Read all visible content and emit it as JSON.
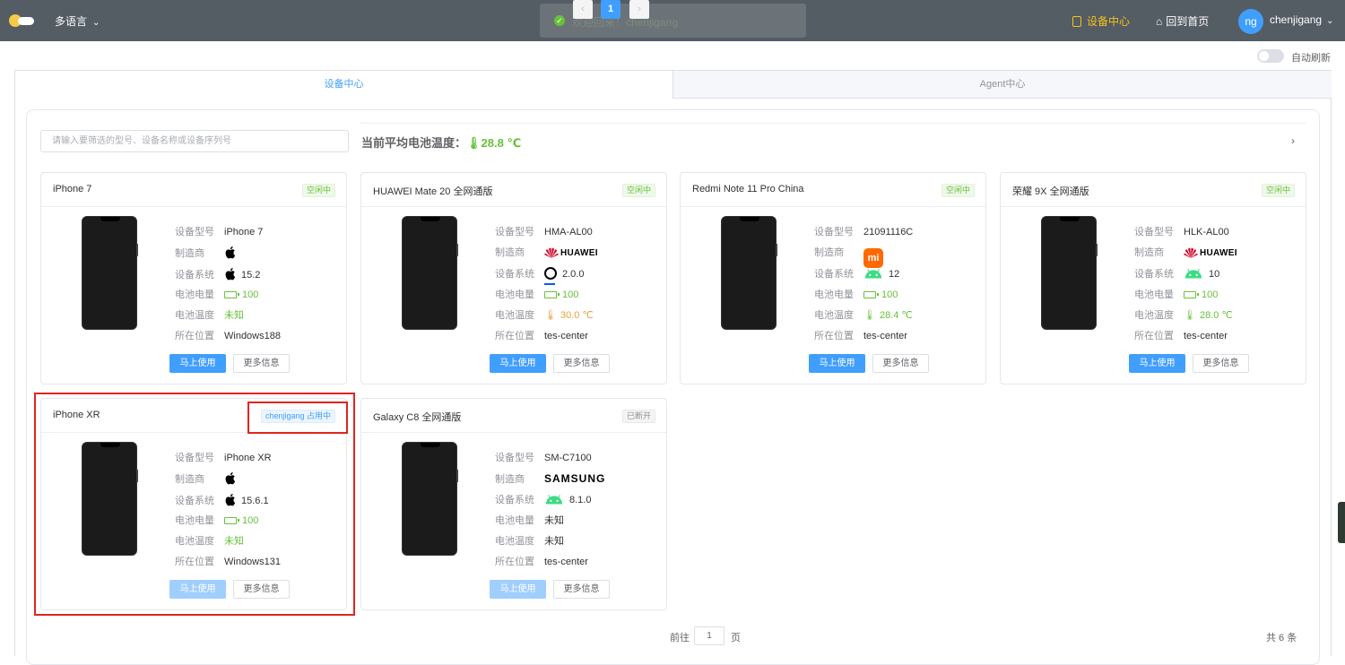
{
  "topbar": {
    "language_label": "多语言",
    "toast_message": "欢迎回来！chenjigang",
    "nav_device_center": "设备中心",
    "nav_home": "回到首页",
    "avatar_initials": "ng",
    "username": "chenjigang"
  },
  "toolbar": {
    "auto_refresh_label": "自动刷新",
    "auto_refresh_on": false
  },
  "tabs": [
    {
      "label": "设备中心",
      "active": true
    },
    {
      "label": "Agent中心",
      "active": false
    }
  ],
  "filter": {
    "search_placeholder": "请输入要筛选的型号、设备名称或设备序列号",
    "avg_temp_label": "当前平均电池温度：",
    "avg_temp_value": "28.8 ℃"
  },
  "field_labels": {
    "model": "设备型号",
    "manufacturer": "制造商",
    "os": "设备系统",
    "battery_level": "电池电量",
    "battery_temp": "电池温度",
    "location": "所在位置"
  },
  "buttons": {
    "use_now": "马上使用",
    "more_info": "更多信息"
  },
  "devices": [
    {
      "title": "iPhone 7",
      "status": "空闲中",
      "model": "iPhone 7",
      "manufacturer_icon": "apple-icon",
      "os_icon": "apple-icon",
      "os_version": "15.2",
      "battery_level": "100",
      "battery_temp": "未知",
      "location": "Windows188"
    },
    {
      "title": "HUAWEI Mate 20 全网通版",
      "status": "空闲中",
      "model": "HMA-AL00",
      "manufacturer_icon": "huawei-logo",
      "manufacturer_text": "HUAWEI",
      "os_icon": "harmonyos-icon",
      "os_version": "2.0.0",
      "battery_level": "100",
      "battery_temp": "30.0 ℃",
      "location": "tes-center"
    },
    {
      "title": "Redmi Note 11 Pro China",
      "status": "空闲中",
      "model": "21091116C",
      "manufacturer_icon": "xiaomi-logo",
      "manufacturer_text": "mi",
      "os_icon": "android-icon",
      "os_version": "12",
      "battery_level": "100",
      "battery_temp": "28.4 ℃",
      "location": "tes-center"
    },
    {
      "title": "荣耀 9X 全网通版",
      "status": "空闲中",
      "model": "HLK-AL00",
      "manufacturer_icon": "huawei-logo",
      "manufacturer_text": "HUAWEI",
      "os_icon": "android-icon",
      "os_version": "10",
      "battery_level": "100",
      "battery_temp": "28.0 ℃",
      "location": "tes-center"
    },
    {
      "title": "iPhone XR",
      "status": "chenjigang 占用中",
      "model": "iPhone XR",
      "manufacturer_icon": "apple-icon",
      "os_icon": "apple-icon",
      "os_version": "15.6.1",
      "battery_level": "100",
      "battery_temp": "未知",
      "location": "Windows131"
    },
    {
      "title": "Galaxy C8 全网通版",
      "status": "已断开",
      "model": "SM-C7100",
      "manufacturer_icon": "samsung-logo",
      "manufacturer_text": "SAMSUNG",
      "os_icon": "android-icon",
      "os_version": "8.1.0",
      "battery_level": "未知",
      "battery_temp": "未知",
      "location": "tes-center"
    }
  ],
  "pagination": {
    "current_page": "1",
    "goto_prefix": "前往",
    "goto_value": "1",
    "goto_suffix": "页",
    "total": "共 6 条"
  },
  "colors": {
    "primary": "#409eff",
    "success": "#67c23a",
    "warning": "#e6a23c",
    "topbar": "#545c64",
    "active_nav": "#f5c318",
    "highlight": "#e0251f"
  }
}
